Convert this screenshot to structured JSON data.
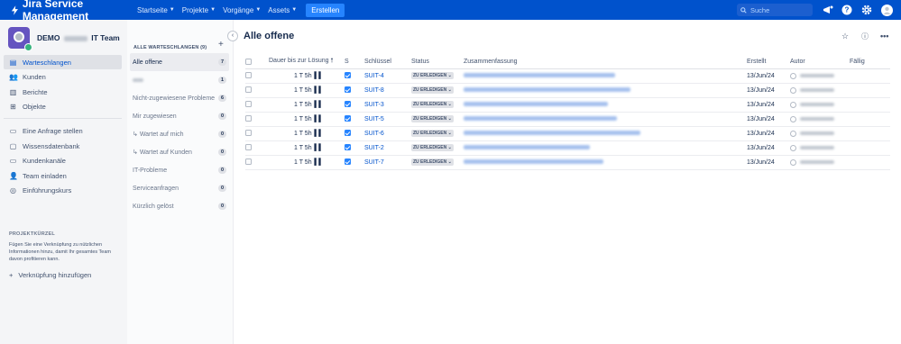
{
  "app": {
    "title": "Jira Service Management"
  },
  "topnav": {
    "items": [
      {
        "label": "Startseite"
      },
      {
        "label": "Projekte"
      },
      {
        "label": "Vorgänge"
      },
      {
        "label": "Assets"
      }
    ],
    "create_label": "Erstellen",
    "search_placeholder": "Suche"
  },
  "project": {
    "name_prefix": "DEMO",
    "name_suffix": "IT Team"
  },
  "sidebar": {
    "items": [
      {
        "label": "Warteschlangen",
        "icon": "queue-icon"
      },
      {
        "label": "Kunden",
        "icon": "customers-icon"
      },
      {
        "label": "Berichte",
        "icon": "reports-icon"
      },
      {
        "label": "Objekte",
        "icon": "objects-icon"
      }
    ],
    "items2": [
      {
        "label": "Eine Anfrage stellen",
        "icon": "raise-request-icon"
      },
      {
        "label": "Wissensdatenbank",
        "icon": "knowledge-base-icon"
      },
      {
        "label": "Kundenkanäle",
        "icon": "channels-icon"
      },
      {
        "label": "Team einladen",
        "icon": "invite-team-icon"
      },
      {
        "label": "Einführungskurs",
        "icon": "onboarding-icon"
      }
    ],
    "shortcuts_heading": "PROJEKTKÜRZEL",
    "shortcuts_text": "Fügen Sie eine Verknüpfung zu nützlichen Informationen hinzu, damit Ihr gesamtes Team davon profitieren kann.",
    "add_shortcut_label": "Verknüpfung hinzufügen"
  },
  "queues": {
    "heading": "ALLE WARTESCHLANGEN (9)",
    "items": [
      {
        "label": "Alle offene",
        "count": "7"
      },
      {
        "label": "",
        "count": "1"
      },
      {
        "label": "Nicht-zugewiesene Probleme",
        "count": "6"
      },
      {
        "label": "Mir zugewiesen",
        "count": "0"
      },
      {
        "label": "Wartet auf mich",
        "count": "0"
      },
      {
        "label": "Wartet auf Kunden",
        "count": "0"
      },
      {
        "label": "IT-Probleme",
        "count": "0"
      },
      {
        "label": "Serviceanfragen",
        "count": "0"
      },
      {
        "label": "Kürzlich gelöst",
        "count": "0"
      }
    ]
  },
  "main": {
    "title": "Alle offene",
    "columns": [
      "Dauer bis zur Lösung",
      "S",
      "Schlüssel",
      "Status",
      "Zusammenfassung",
      "Erstellt",
      "Autor",
      "Fällig"
    ],
    "rows": [
      {
        "sla": "1 T 5h",
        "key": "SUIT-4",
        "status": "ZU ERLEDIGEN",
        "created": "13/Jun/24"
      },
      {
        "sla": "1 T 5h",
        "key": "SUIT-8",
        "status": "ZU ERLEDIGEN",
        "created": "13/Jun/24"
      },
      {
        "sla": "1 T 5h",
        "key": "SUIT-3",
        "status": "ZU ERLEDIGEN",
        "created": "13/Jun/24"
      },
      {
        "sla": "1 T 5h",
        "key": "SUIT-5",
        "status": "ZU ERLEDIGEN",
        "created": "13/Jun/24"
      },
      {
        "sla": "1 T 5h",
        "key": "SUIT-6",
        "status": "ZU ERLEDIGEN",
        "created": "13/Jun/24"
      },
      {
        "sla": "1 T 5h",
        "key": "SUIT-2",
        "status": "ZU ERLEDIGEN",
        "created": "13/Jun/24"
      },
      {
        "sla": "1 T 5h",
        "key": "SUIT-7",
        "status": "ZU ERLEDIGEN",
        "created": "13/Jun/24"
      }
    ]
  },
  "colors": {
    "brand": "#0052cc",
    "create": "#2684ff",
    "checkbox": "#2684ff"
  }
}
